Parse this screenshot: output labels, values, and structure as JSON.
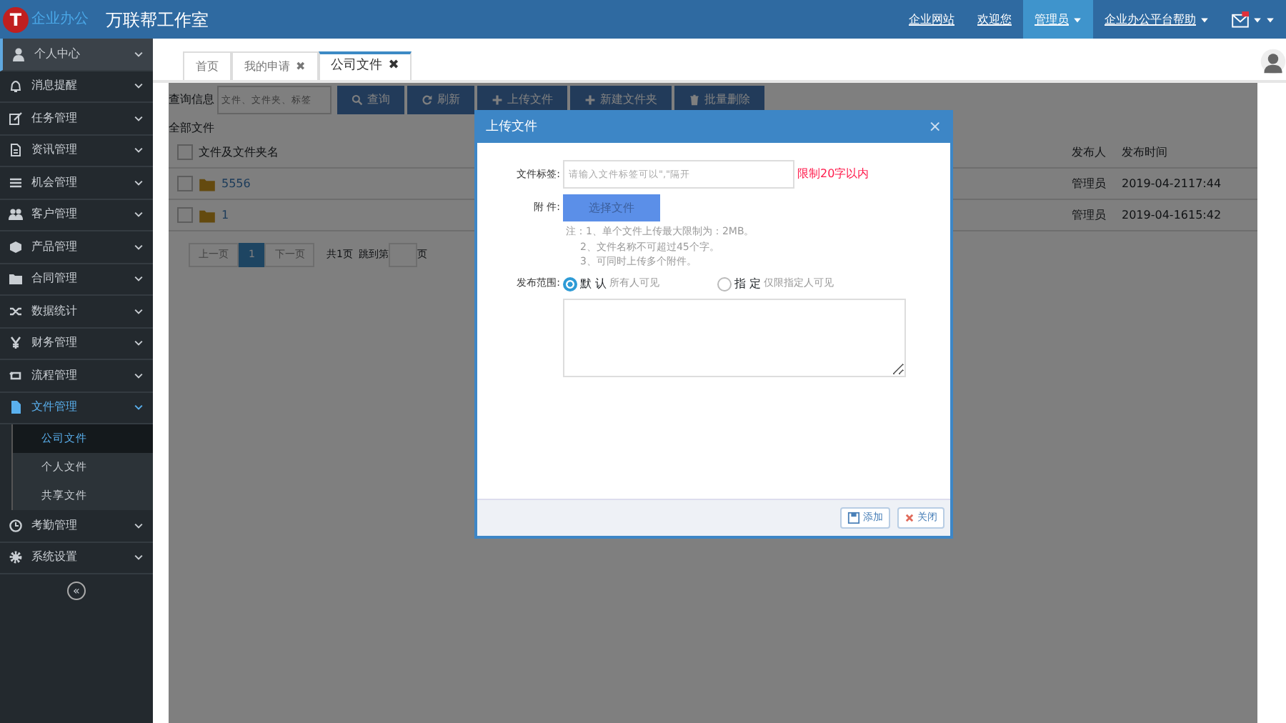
{
  "header": {
    "logo_letter": "T",
    "logo_text": "企业办公",
    "title": "万联帮工作室",
    "nav": [
      {
        "label": "企业网站",
        "selected": false,
        "caret": false
      },
      {
        "label": "欢迎您",
        "selected": false,
        "caret": false
      },
      {
        "label": "管理员",
        "selected": true,
        "caret": true
      },
      {
        "label": "企业办公平台帮助",
        "selected": false,
        "caret": true
      }
    ]
  },
  "sidebar": {
    "items": [
      {
        "label": "个人中心",
        "selected": true,
        "expanded": false
      },
      {
        "label": "消息提醒",
        "selected": false,
        "expanded": false
      },
      {
        "label": "任务管理",
        "selected": false,
        "expanded": false
      },
      {
        "label": "资讯管理",
        "selected": false,
        "expanded": false
      },
      {
        "label": "机会管理",
        "selected": false,
        "expanded": false
      },
      {
        "label": "客户管理",
        "selected": false,
        "expanded": false
      },
      {
        "label": "产品管理",
        "selected": false,
        "expanded": false
      },
      {
        "label": "合同管理",
        "selected": false,
        "expanded": false
      },
      {
        "label": "数据统计",
        "selected": false,
        "expanded": false
      },
      {
        "label": "财务管理",
        "selected": false,
        "expanded": false
      },
      {
        "label": "流程管理",
        "selected": false,
        "expanded": false
      },
      {
        "label": "文件管理",
        "selected": false,
        "expanded": true,
        "children": [
          {
            "label": "公司文件",
            "selected": true
          },
          {
            "label": "个人文件",
            "selected": false
          },
          {
            "label": "共享文件",
            "selected": false
          }
        ]
      },
      {
        "label": "考勤管理",
        "selected": false,
        "expanded": false
      },
      {
        "label": "系统设置",
        "selected": false,
        "expanded": false
      }
    ],
    "collapse": "«"
  },
  "tabs": [
    {
      "label": "首页",
      "selected": false,
      "closable": false
    },
    {
      "label": "我的申请",
      "selected": false,
      "closable": true
    },
    {
      "label": "公司文件",
      "selected": true,
      "closable": true
    }
  ],
  "tab_close": "✖",
  "search": {
    "label": "查询信息",
    "placeholder": "文件、文件夹、标签"
  },
  "toolbar": [
    {
      "label": "查询"
    },
    {
      "label": "刷新"
    },
    {
      "label": "上传文件"
    },
    {
      "label": "新建文件夹"
    },
    {
      "label": "批量删除"
    }
  ],
  "breadcrumb": "全部文件",
  "table": {
    "all_checked": false,
    "columns": [
      "文件及文件夹名",
      "发布人",
      "发布时间"
    ],
    "rows": [
      {
        "name": "5556",
        "publisher": "管理员",
        "time": "2019-04-2117:44",
        "checked": false,
        "link": true
      },
      {
        "name": "1",
        "publisher": "管理员",
        "time": "2019-04-1615:42",
        "checked": false,
        "link": true
      }
    ]
  },
  "pagination": {
    "prev": "上一页",
    "pages": [
      {
        "label": "1",
        "selected": true
      }
    ],
    "next": "下一页",
    "total": "共1页",
    "jump_label": "跳到第",
    "jump_suffix": "页"
  },
  "modal": {
    "title": "上传文件",
    "close": "×",
    "title_field": {
      "label": "文件标签:",
      "placeholder": "请输入文件标签可以\",\"隔开",
      "hint": "限制20字以内"
    },
    "attach": {
      "label": "附 件:",
      "button": "选择文件"
    },
    "notes": [
      "注：1、单个文件上传最大限制为：2MB。",
      "2、文件名称不可超过45个字。",
      "3、可同时上传多个附件。"
    ],
    "scope": {
      "label": "发布范围:",
      "options": [
        {
          "label": "默 认",
          "desc": "所有人可见",
          "selected": true
        },
        {
          "label": "指 定",
          "desc": "仅限指定人可见",
          "selected": false
        }
      ]
    },
    "buttons": [
      {
        "label": "添加",
        "kind": "save"
      },
      {
        "label": "关闭",
        "kind": "close"
      }
    ]
  }
}
